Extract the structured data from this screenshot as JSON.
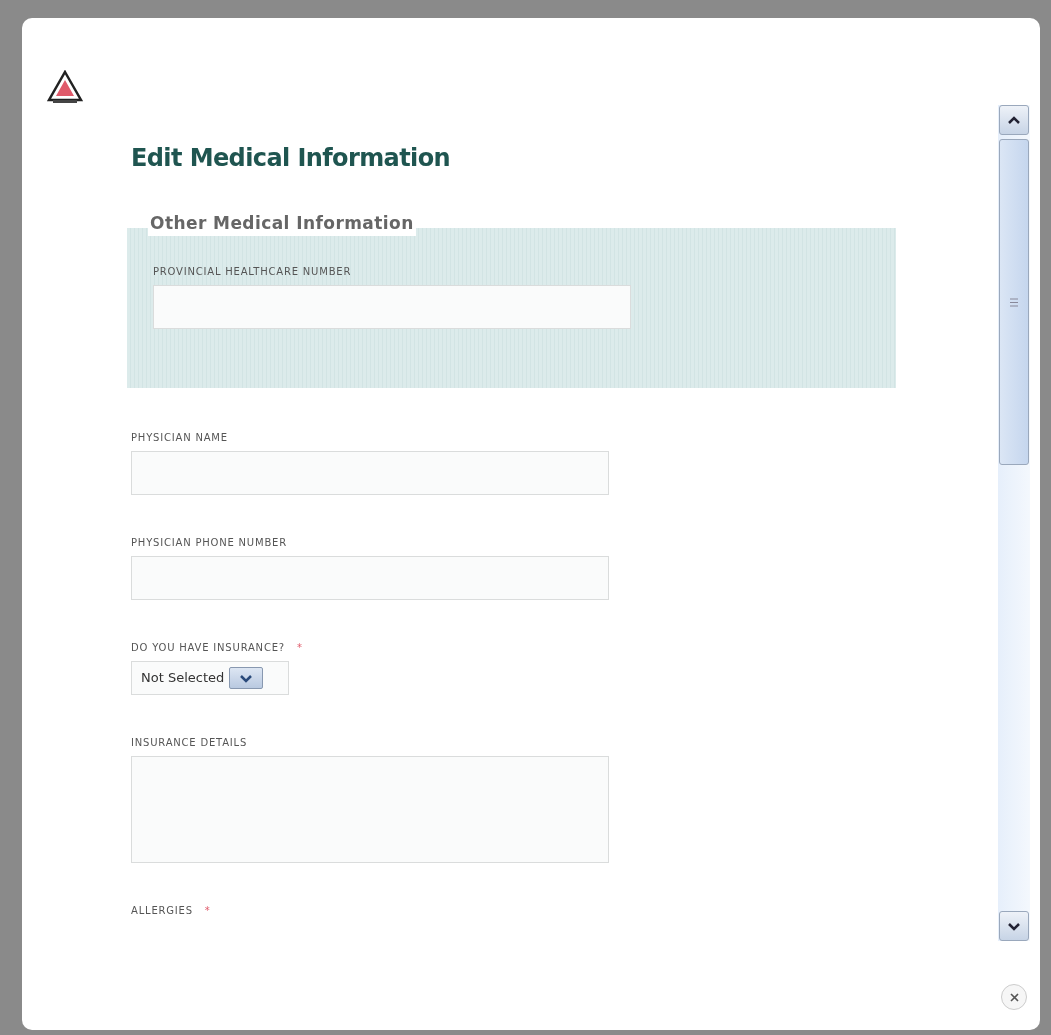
{
  "dialog": {
    "title": "Edit Medical Information",
    "section": {
      "legend": "Other Medical Information",
      "fields": [
        {
          "kind": "text",
          "label": "PROVINCIAL HEALTHCARE NUMBER"
        }
      ]
    },
    "fields": [
      {
        "kind": "text",
        "label": "PHYSICIAN NAME"
      },
      {
        "kind": "text",
        "label": "PHYSICIAN PHONE NUMBER"
      },
      {
        "kind": "select",
        "label": "DO YOU HAVE INSURANCE?",
        "required_mark": "*",
        "value": "Not Selected"
      },
      {
        "kind": "textarea",
        "label": "INSURANCE DETAILS"
      },
      {
        "kind": "label",
        "label": "ALLERGIES",
        "required_mark": "*"
      }
    ]
  }
}
